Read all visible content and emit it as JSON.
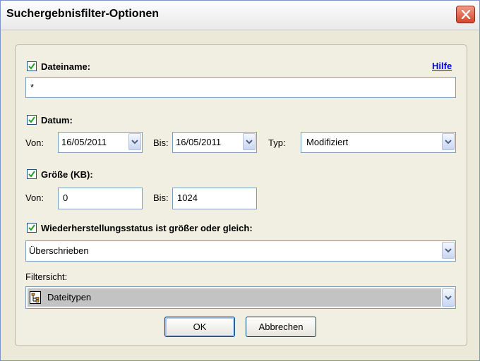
{
  "window": {
    "title": "Suchergebnisfilter-Optionen"
  },
  "filename": {
    "label": "Dateiname:",
    "checked": true,
    "help_link": "Hilfe",
    "value": "*"
  },
  "date": {
    "label": "Datum:",
    "checked": true,
    "from_label": "Von:",
    "from_value": "16/05/2011",
    "to_label": "Bis:",
    "to_value": "16/05/2011",
    "type_label": "Typ:",
    "type_value": "Modifiziert"
  },
  "size": {
    "label": "Größe (KB):",
    "checked": true,
    "from_label": "Von:",
    "from_value": "0",
    "to_label": "Bis:",
    "to_value": "1024"
  },
  "recovery": {
    "label": "Wiederherstellungsstatus ist größer oder gleich:",
    "checked": true,
    "value": "Überschrieben"
  },
  "filter_view": {
    "label": "Filtersicht:",
    "value": "Dateitypen",
    "icon": "file-tree-icon"
  },
  "buttons": {
    "ok": "OK",
    "cancel": "Abbrechen"
  },
  "colors": {
    "check_green": "#21a121",
    "link_blue": "#0000ee",
    "close_red": "#d5452a"
  }
}
